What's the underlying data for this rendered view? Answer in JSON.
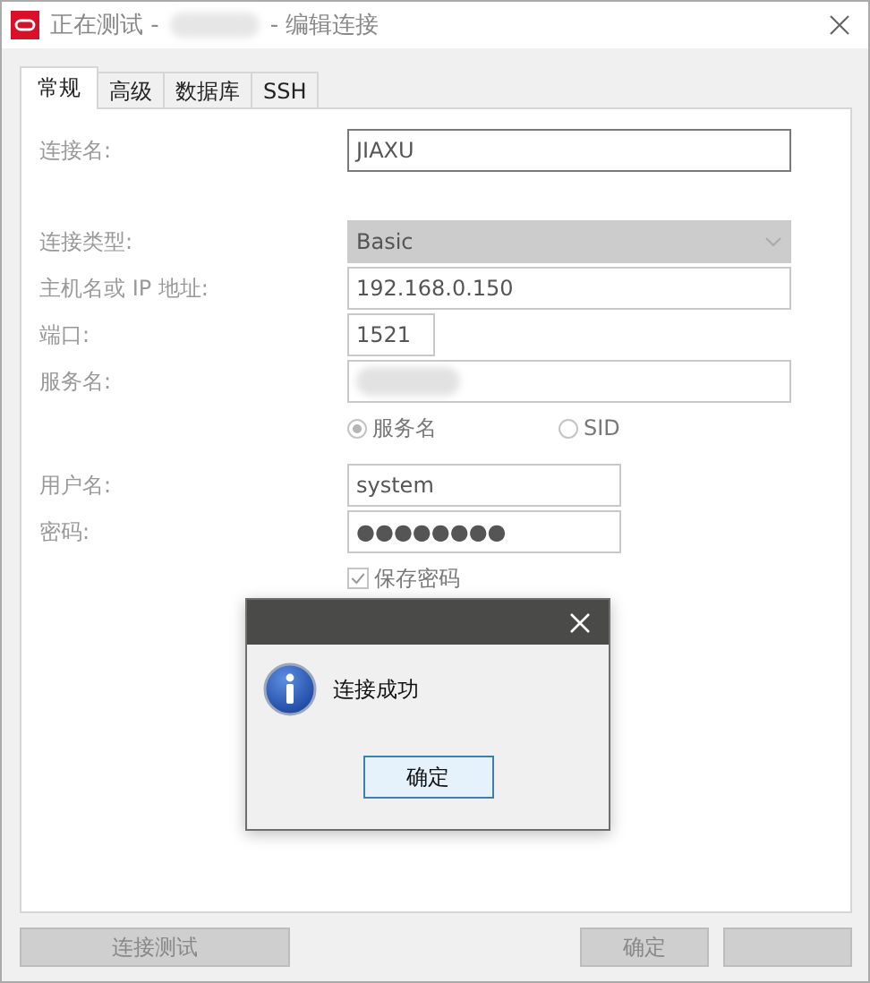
{
  "window": {
    "title_before": "正在测试 -",
    "title_redacted": true,
    "title_after": "- 编辑连接"
  },
  "tabs": [
    {
      "label": "常规",
      "selected": true
    },
    {
      "label": "高级",
      "selected": false
    },
    {
      "label": "数据库",
      "selected": false
    },
    {
      "label": "SSH",
      "selected": false
    }
  ],
  "sections": [
    [
      {
        "kind": "text",
        "label": "连接名:",
        "value": "JIAXU",
        "disabled": false
      }
    ],
    [
      {
        "kind": "select",
        "label": "连接类型:",
        "value": "Basic",
        "disabled": true
      },
      {
        "kind": "text",
        "label": "主机名或 IP 地址:",
        "value": "192.168.0.150",
        "disabled": true
      },
      {
        "kind": "text",
        "label": "端口:",
        "value": "1521",
        "disabled": true
      },
      {
        "kind": "text",
        "label": "服务名:",
        "redacted": true,
        "disabled": true
      },
      {
        "kind": "radios",
        "options": [
          {
            "label": "服务名",
            "selected": true
          },
          {
            "label": "SID",
            "selected": false
          }
        ]
      }
    ],
    [
      {
        "kind": "text",
        "label": "用户名:",
        "value": "system",
        "disabled": true
      },
      {
        "kind": "text",
        "label": "密码:",
        "value": "●●●●●●●●",
        "disabled": true
      },
      {
        "kind": "checkbox",
        "label": "保存密码",
        "checked": true
      }
    ]
  ],
  "buttons": [
    {
      "label": "连接测试",
      "disabled": true
    },
    {
      "label": "确定",
      "disabled": true
    },
    {
      "disabled": true
    }
  ],
  "message_box": {
    "text": "连接成功",
    "button": "确定"
  }
}
